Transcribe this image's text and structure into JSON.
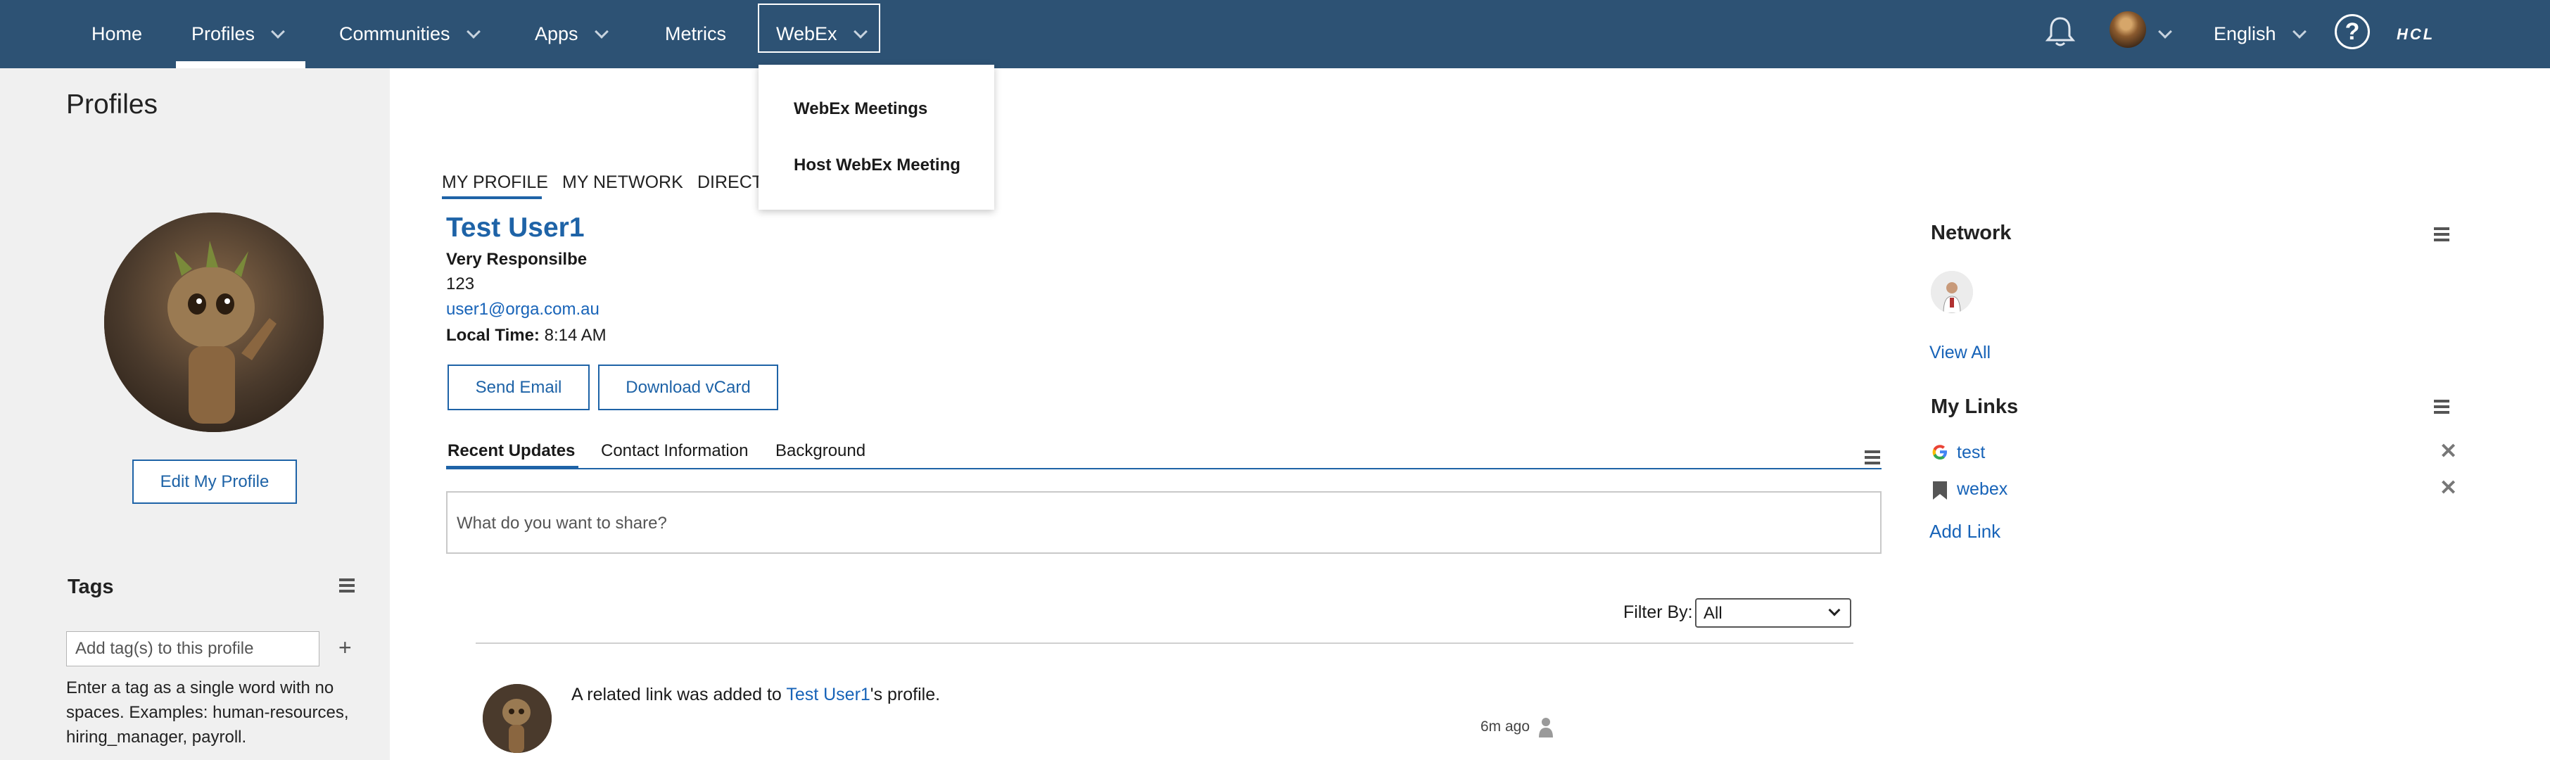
{
  "nav": {
    "items": [
      {
        "label": "Home",
        "has_dropdown": false
      },
      {
        "label": "Profiles",
        "has_dropdown": true,
        "active": true
      },
      {
        "label": "Communities",
        "has_dropdown": true
      },
      {
        "label": "Apps",
        "has_dropdown": true
      },
      {
        "label": "Metrics",
        "has_dropdown": false
      },
      {
        "label": "WebEx",
        "has_dropdown": true,
        "open": true
      }
    ],
    "language": "English",
    "help_label": "?",
    "brand": "HCL"
  },
  "webex_menu": {
    "items": [
      "WebEx Meetings",
      "Host WebEx Meeting"
    ]
  },
  "left": {
    "title": "Profiles",
    "edit_button": "Edit My Profile",
    "tags": {
      "title": "Tags",
      "input_placeholder": "Add tag(s) to this profile",
      "add_icon": "+",
      "help": "Enter a tag as a single word with no spaces. Examples: human-resources, hiring_manager, payroll."
    }
  },
  "profile_tabs": [
    "MY PROFILE",
    "MY NETWORK",
    "DIRECTO"
  ],
  "profile": {
    "name": "Test User1",
    "title": "Very Responsilbe",
    "extension": "123",
    "email": "user1@orga.com.au",
    "local_time_label": "Local Time:",
    "local_time": "8:14 AM",
    "send_email": "Send Email",
    "download_vcard": "Download vCard"
  },
  "content_tabs": [
    "Recent Updates",
    "Contact Information",
    "Background"
  ],
  "share_placeholder": "What do you want to share?",
  "filter": {
    "label": "Filter By:",
    "value": "All"
  },
  "feed": [
    {
      "prefix": "A related link was added to ",
      "link": "Test User1",
      "suffix": "'s profile.",
      "time": "6m ago"
    }
  ],
  "right": {
    "network_title": "Network",
    "view_all": "View All",
    "links_title": "My Links",
    "links": [
      {
        "label": "test",
        "icon": "google-icon"
      },
      {
        "label": "webex",
        "icon": "bookmark-icon"
      }
    ],
    "add_link": "Add Link"
  },
  "colors": {
    "nav_bg": "#2d5274",
    "link_blue": "#1763b8",
    "accent_blue": "#1e63a7",
    "left_panel_bg": "#f0f0f0"
  }
}
